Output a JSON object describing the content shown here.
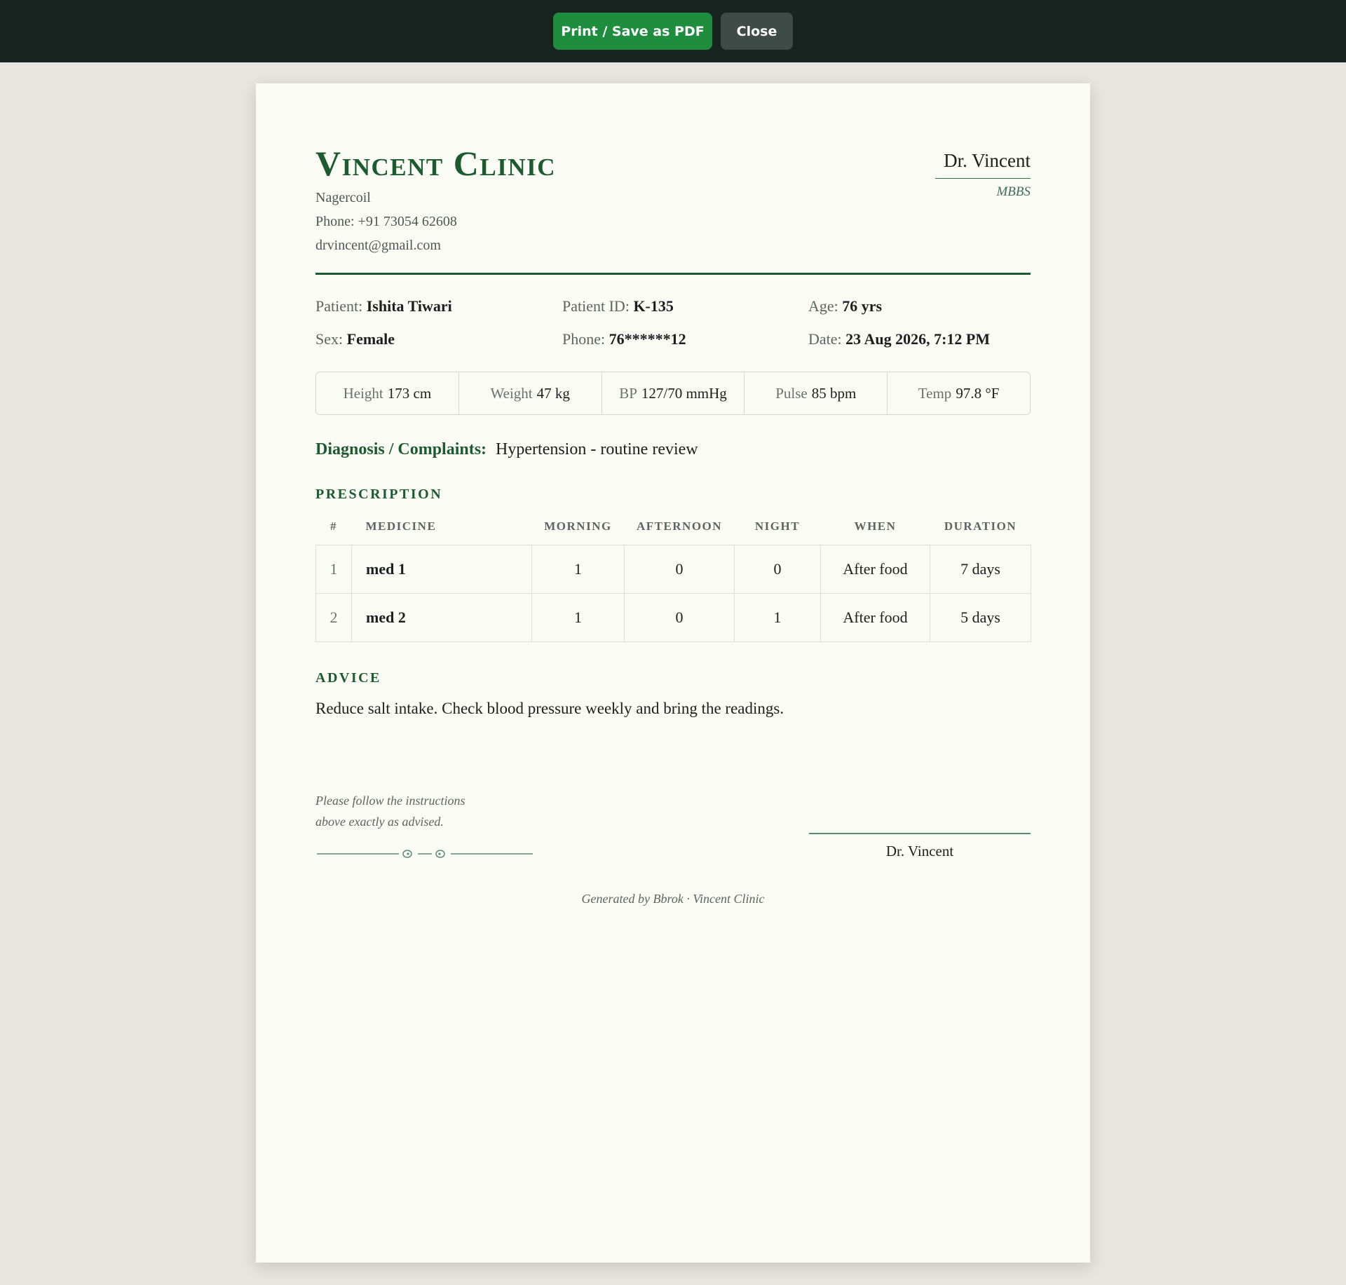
{
  "toolbar": {
    "print_label": "Print / Save as PDF",
    "close_label": "Close"
  },
  "clinic": {
    "name": "Vincent Clinic",
    "city": "Nagercoil",
    "phone": "Phone: +91 73054 62608",
    "email": "drvincent@gmail.com"
  },
  "doctor": {
    "name": "Dr. Vincent",
    "qualification": "MBBS"
  },
  "patient": {
    "name_label": "Patient:",
    "name": "Ishita Tiwari",
    "id_label": "Patient ID:",
    "id": "K-135",
    "age_label": "Age:",
    "age": "76 yrs",
    "sex_label": "Sex:",
    "sex": "Female",
    "phone_label": "Phone:",
    "phone": "76******12",
    "date_label": "Date:",
    "date": "23 Aug 2026, 7:12 PM"
  },
  "vitals": [
    {
      "label": "Height",
      "value": "173 cm"
    },
    {
      "label": "Weight",
      "value": "47 kg"
    },
    {
      "label": "BP",
      "value": "127/70 mmHg"
    },
    {
      "label": "Pulse",
      "value": "85 bpm"
    },
    {
      "label": "Temp",
      "value": "97.8 °F"
    }
  ],
  "diagnosis": {
    "label": "Diagnosis / Complaints:",
    "text": "Hypertension - routine review"
  },
  "prescription": {
    "title": "PRESCRIPTION",
    "headers": [
      "#",
      "MEDICINE",
      "MORNING",
      "AFTERNOON",
      "NIGHT",
      "WHEN",
      "DURATION"
    ],
    "rows": [
      {
        "num": "1",
        "medicine": "med 1",
        "morning": "1",
        "afternoon": "0",
        "night": "0",
        "when": "After food",
        "duration": "7 days"
      },
      {
        "num": "2",
        "medicine": "med 2",
        "morning": "1",
        "afternoon": "0",
        "night": "1",
        "when": "After food",
        "duration": "5 days"
      }
    ]
  },
  "advice": {
    "title": "ADVICE",
    "text": "Reduce salt intake. Check blood pressure weekly and bring the readings."
  },
  "note": {
    "line1": "Please follow the instructions",
    "line2": "above exactly as advised."
  },
  "signature": {
    "name": "Dr. Vincent"
  },
  "footer": {
    "text": "Generated by Bbrok · Vincent Clinic"
  },
  "colors": {
    "topbar": "#17241f",
    "print_button": "#1f8d3e",
    "close_button": "#3f4b47",
    "accent_green": "#1c5a30",
    "paper": "#fbfbf6",
    "page_background": "#e6e5e0"
  }
}
